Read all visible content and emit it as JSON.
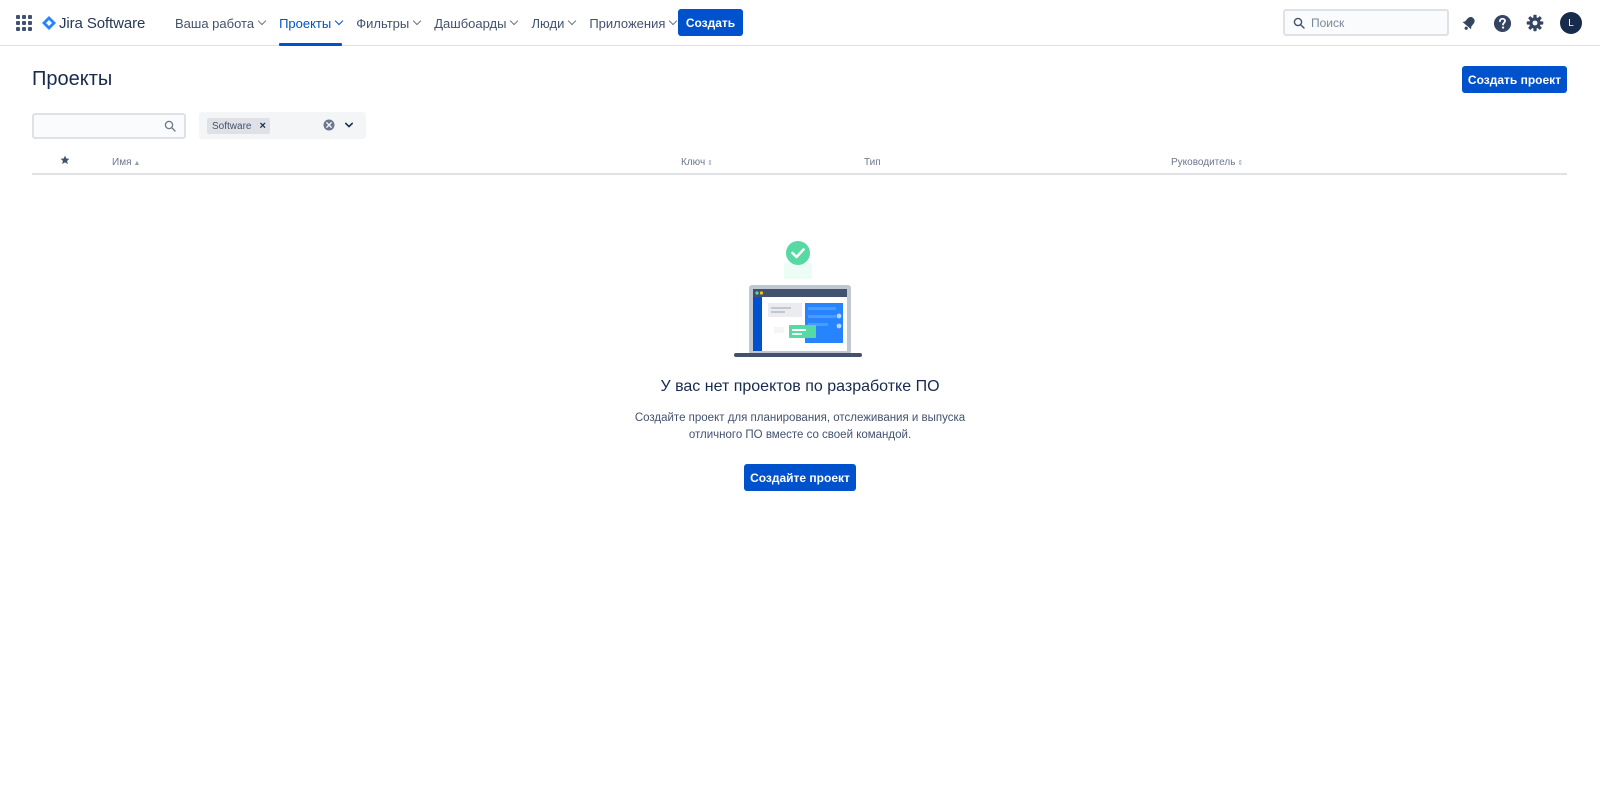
{
  "app": {
    "logo_text": "Jira Software",
    "icons": [
      "app-switcher-icon",
      "jira-logo-icon"
    ]
  },
  "nav": {
    "items": [
      {
        "label": "Ваша работа",
        "active": false
      },
      {
        "label": "Проекты",
        "active": true
      },
      {
        "label": "Фильтры",
        "active": false
      },
      {
        "label": "Дашбоарды",
        "active": false
      },
      {
        "label": "Люди",
        "active": false
      },
      {
        "label": "Приложения",
        "active": false
      }
    ],
    "create_label": "Создать",
    "search_placeholder": "Поиск",
    "search_value": "",
    "right_icons": [
      "notifications-icon",
      "help-icon",
      "settings-icon"
    ],
    "avatar_initial": "L"
  },
  "page": {
    "title": "Проекты",
    "create_project_label": "Создать проект"
  },
  "filters": {
    "search_value": "",
    "type_chip": "Software",
    "chip_remove": "×"
  },
  "table": {
    "columns": [
      {
        "key": "star",
        "label": "",
        "icon": "star-icon"
      },
      {
        "key": "name",
        "label": "Имя",
        "sorted": "asc"
      },
      {
        "key": "key",
        "label": "Ключ"
      },
      {
        "key": "type",
        "label": "Тип"
      },
      {
        "key": "lead",
        "label": "Руководитель"
      }
    ],
    "rows": []
  },
  "empty_state": {
    "title": "У вас нет проектов по разработке ПО",
    "description": "Создайте проект для планирования, отслеживания и выпуска отличного ПО вместе со своей командой.",
    "button_label": "Создайте проект",
    "illustration": "laptop-with-checkmark-illustration"
  },
  "colors": {
    "primary": "#0052cc",
    "text": "#172b4d",
    "subtle_text": "#42526e",
    "border": "#dfe1e6",
    "success": "#57d9a3"
  }
}
